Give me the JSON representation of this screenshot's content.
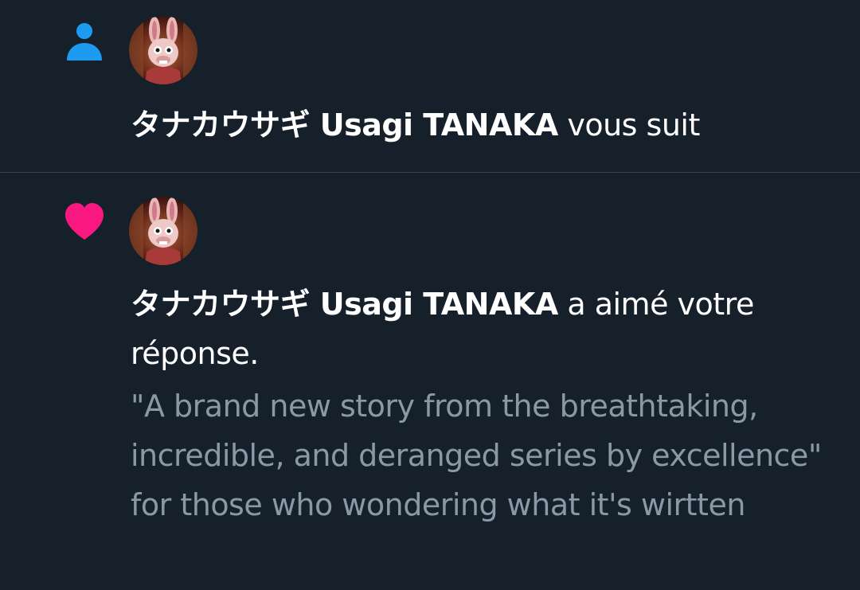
{
  "colors": {
    "background": "#15202b",
    "divider": "#38444d",
    "follow_icon": "#1d9bf0",
    "like_icon": "#f91880",
    "primary_text": "#ffffff",
    "secondary_text": "#8b98a5"
  },
  "notifications": [
    {
      "type_icon": "person-icon",
      "user_name": "タナカウサギ Usagi TANAKA",
      "action": " vous suit"
    },
    {
      "type_icon": "heart-icon",
      "user_name": "タナカウサギ Usagi TANAKA",
      "action": " a aimé votre réponse.",
      "quoted_text": "\"A brand new story from the breathtaking, incredible, and deranged series by excellence\" for those who wondering what it's wirtten"
    }
  ]
}
